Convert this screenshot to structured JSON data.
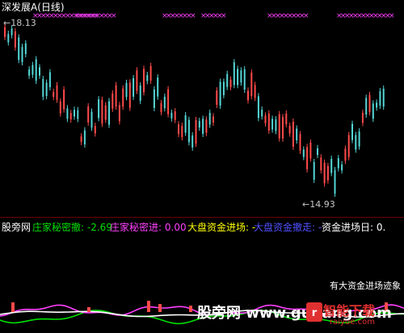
{
  "main": {
    "title": "深发展A(日线)",
    "price_high": "18.13",
    "price_low": "14.93"
  },
  "indicator": {
    "name": "股旁网",
    "line1_label": "庄家秘密撤:",
    "line1_value": "-2.69",
    "line2_label": "庄家秘密进:",
    "line2_value": "0.00",
    "line3_label": "大盘资金进场:",
    "line3_value": "-",
    "line4_label": "大盘资金撤走:",
    "line4_value": "-",
    "line5_label": "资金进场日:",
    "line5_value": "0."
  },
  "notice": "有大资金进场迹象",
  "watermark": "股旁网 www.gupang.com",
  "logo": {
    "text": "智能下载",
    "domain": "raiyue.com"
  },
  "colors": {
    "bg": "#000000",
    "up": "#ff4a4a",
    "down": "#54d6d6",
    "marker": "#ff40ff",
    "line1": "#00e000",
    "line2": "#ff40ff",
    "line3": "#ffff00",
    "line4": "#5050ff",
    "line5": "#ffffff"
  }
}
